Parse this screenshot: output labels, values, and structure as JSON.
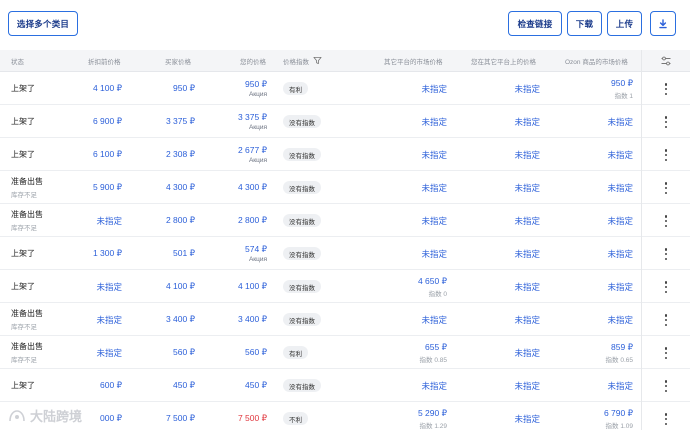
{
  "toolbar": {
    "select_categories": "选择多个类目",
    "check_links": "检查链接",
    "download": "下载",
    "upload": "上传"
  },
  "icons": {
    "download_icon": "download-arrow-icon",
    "filter_icon": "funnel-icon",
    "settings_icon": "sliders-icon",
    "row_menu_icon": "kebab-menu-icon"
  },
  "headers": {
    "status": "状态",
    "price_before_discount": "折扣前价格",
    "your_price": "买家价格",
    "ozon_price": "您的价格",
    "price_index": "价格指数",
    "competitor_market_price": "其它平台的市场价格",
    "your_other_market_price": "您在其它平台上的价格",
    "ozon_market_price": "Ozon 商品的市场价格"
  },
  "rows": [
    {
      "status": "上架了",
      "status_sub": "",
      "old_price": "4 100 ₽",
      "buyer_price": "950 ₽",
      "your_price": "950 ₽",
      "your_price_sub": "Акция",
      "badge": "有利",
      "competitor": "未指定",
      "competitor_sub": "",
      "other": "未指定",
      "ozon": "950 ₽",
      "ozon_sub": "指数 1",
      "red": false
    },
    {
      "status": "上架了",
      "status_sub": "",
      "old_price": "6 900 ₽",
      "buyer_price": "3 375 ₽",
      "your_price": "3 375 ₽",
      "your_price_sub": "Акция",
      "badge": "没有指数",
      "competitor": "未指定",
      "competitor_sub": "",
      "other": "未指定",
      "ozon": "未指定",
      "ozon_sub": "",
      "red": false
    },
    {
      "status": "上架了",
      "status_sub": "",
      "old_price": "6 100 ₽",
      "buyer_price": "2 308 ₽",
      "your_price": "2 677 ₽",
      "your_price_sub": "Акция",
      "badge": "没有指数",
      "competitor": "未指定",
      "competitor_sub": "",
      "other": "未指定",
      "ozon": "未指定",
      "ozon_sub": "",
      "red": false
    },
    {
      "status": "准备出售",
      "status_sub": "库存不足",
      "old_price": "5 900 ₽",
      "buyer_price": "4 300 ₽",
      "your_price": "4 300 ₽",
      "your_price_sub": "",
      "badge": "没有指数",
      "competitor": "未指定",
      "competitor_sub": "",
      "other": "未指定",
      "ozon": "未指定",
      "ozon_sub": "",
      "red": false
    },
    {
      "status": "准备出售",
      "status_sub": "库存不足",
      "old_price": "未指定",
      "buyer_price": "2 800 ₽",
      "your_price": "2 800 ₽",
      "your_price_sub": "",
      "badge": "没有指数",
      "competitor": "未指定",
      "competitor_sub": "",
      "other": "未指定",
      "ozon": "未指定",
      "ozon_sub": "",
      "red": false
    },
    {
      "status": "上架了",
      "status_sub": "",
      "old_price": "1 300 ₽",
      "buyer_price": "501 ₽",
      "your_price": "574 ₽",
      "your_price_sub": "Акция",
      "badge": "没有指数",
      "competitor": "未指定",
      "competitor_sub": "",
      "other": "未指定",
      "ozon": "未指定",
      "ozon_sub": "",
      "red": false
    },
    {
      "status": "上架了",
      "status_sub": "",
      "old_price": "未指定",
      "buyer_price": "4 100 ₽",
      "your_price": "4 100 ₽",
      "your_price_sub": "",
      "badge": "没有指数",
      "competitor": "4 650 ₽",
      "competitor_sub": "指数 0",
      "other": "未指定",
      "ozon": "未指定",
      "ozon_sub": "",
      "red": false
    },
    {
      "status": "准备出售",
      "status_sub": "库存不足",
      "old_price": "未指定",
      "buyer_price": "3 400 ₽",
      "your_price": "3 400 ₽",
      "your_price_sub": "",
      "badge": "没有指数",
      "competitor": "未指定",
      "competitor_sub": "",
      "other": "未指定",
      "ozon": "未指定",
      "ozon_sub": "",
      "red": false
    },
    {
      "status": "准备出售",
      "status_sub": "库存不足",
      "old_price": "未指定",
      "buyer_price": "560 ₽",
      "your_price": "560 ₽",
      "your_price_sub": "",
      "badge": "有利",
      "competitor": "655 ₽",
      "competitor_sub": "指数 0.85",
      "other": "未指定",
      "ozon": "859 ₽",
      "ozon_sub": "指数 0.65",
      "red": false
    },
    {
      "status": "上架了",
      "status_sub": "",
      "old_price": "600 ₽",
      "buyer_price": "450 ₽",
      "your_price": "450 ₽",
      "your_price_sub": "",
      "badge": "没有指数",
      "competitor": "未指定",
      "competitor_sub": "",
      "other": "未指定",
      "ozon": "未指定",
      "ozon_sub": "",
      "red": false
    },
    {
      "status": "",
      "status_sub": "",
      "old_price": "000 ₽",
      "buyer_price": "7 500 ₽",
      "your_price": "7 500 ₽",
      "your_price_sub": "",
      "badge": "不利",
      "competitor": "5 290 ₽",
      "competitor_sub": "指数 1.29",
      "other": "未指定",
      "ozon": "6 790 ₽",
      "ozon_sub": "指数 1.09",
      "red": true
    }
  ],
  "watermark": "大陆跨境"
}
